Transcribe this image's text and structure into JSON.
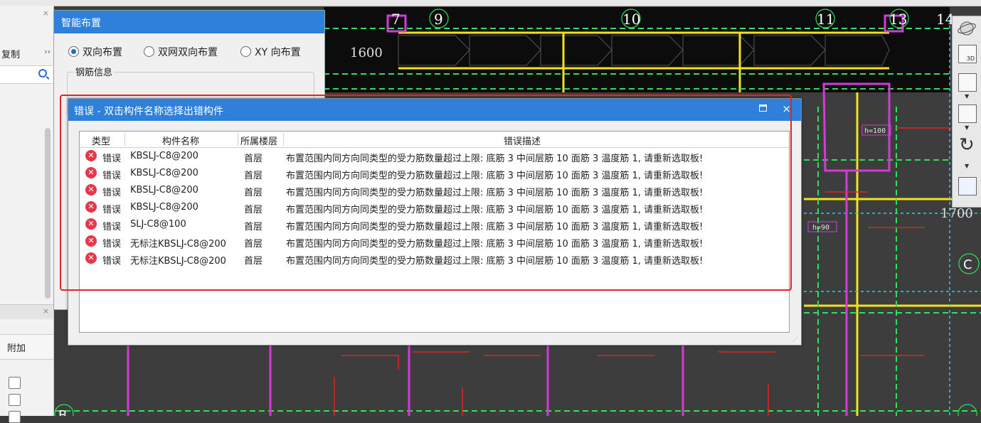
{
  "cad": {
    "grid_labels": [
      "7",
      "9",
      "10",
      "11",
      "13",
      "14"
    ],
    "dimension_1600": "1600",
    "dimension_1700": "1700",
    "axis_c": "C",
    "axis_b": "B",
    "tag_h100": "h=100",
    "tag_h90": "h=90"
  },
  "left_panel": {
    "copy_label": "复制",
    "more": "››",
    "close": "×",
    "extra_header": "附加"
  },
  "smart_dialog": {
    "title": "智能布置",
    "radio_options": [
      {
        "label": "双向布置",
        "selected": true
      },
      {
        "label": "双网双向布置",
        "selected": false
      },
      {
        "label": "XY 向布置",
        "selected": false
      }
    ],
    "rebar_info_label": "钢筋信息"
  },
  "error_dialog": {
    "title": "错误 - 双击构件名称选择出错构件",
    "close": "×",
    "columns": [
      "类型",
      "构件名称",
      "所属楼层",
      "错误描述"
    ],
    "rows": [
      {
        "type": "错误",
        "name": "KBSLJ-C8@200",
        "floor": "首层",
        "desc": "布置范围内同方向同类型的受力筋数量超过上限: 底筋 3 中间层筋 10 面筋 3 温度筋 1, 请重新选取板!"
      },
      {
        "type": "错误",
        "name": "KBSLJ-C8@200",
        "floor": "首层",
        "desc": "布置范围内同方向同类型的受力筋数量超过上限: 底筋 3 中间层筋 10 面筋 3 温度筋 1, 请重新选取板!"
      },
      {
        "type": "错误",
        "name": "KBSLJ-C8@200",
        "floor": "首层",
        "desc": "布置范围内同方向同类型的受力筋数量超过上限: 底筋 3 中间层筋 10 面筋 3 温度筋 1, 请重新选取板!"
      },
      {
        "type": "错误",
        "name": "KBSLJ-C8@200",
        "floor": "首层",
        "desc": "布置范围内同方向同类型的受力筋数量超过上限: 底筋 3 中间层筋 10 面筋 3 温度筋 1, 请重新选取板!"
      },
      {
        "type": "错误",
        "name": "SLJ-C8@100",
        "floor": "首层",
        "desc": "布置范围内同方向同类型的受力筋数量超过上限: 底筋 3 中间层筋 10 面筋 3 温度筋 1, 请重新选取板!"
      },
      {
        "type": "错误",
        "name": "无标注KBSLJ-C8@200",
        "floor": "首层",
        "desc": "布置范围内同方向同类型的受力筋数量超过上限: 底筋 3 中间层筋 10 面筋 3 温度筋 1, 请重新选取板!"
      },
      {
        "type": "错误",
        "name": "无标注KBSLJ-C8@200",
        "floor": "首层",
        "desc": "布置范围内同方向同类型的受力筋数量超过上限: 底筋 3 中间层筋 10 面筋 3 温度筋 1, 请重新选取板!"
      }
    ]
  },
  "view_toolbar": {
    "icons": [
      "orbit-icon",
      "view-3d-icon",
      "front-view-icon",
      "top-view-icon",
      "rotate-icon",
      "layer-icon"
    ],
    "view_3d_label": "3D"
  },
  "colors": {
    "title_bar": "#2f80db",
    "error_icon": "#e6384a",
    "highlight": "#e0262a",
    "cad_bg": "#3b3b3b"
  }
}
